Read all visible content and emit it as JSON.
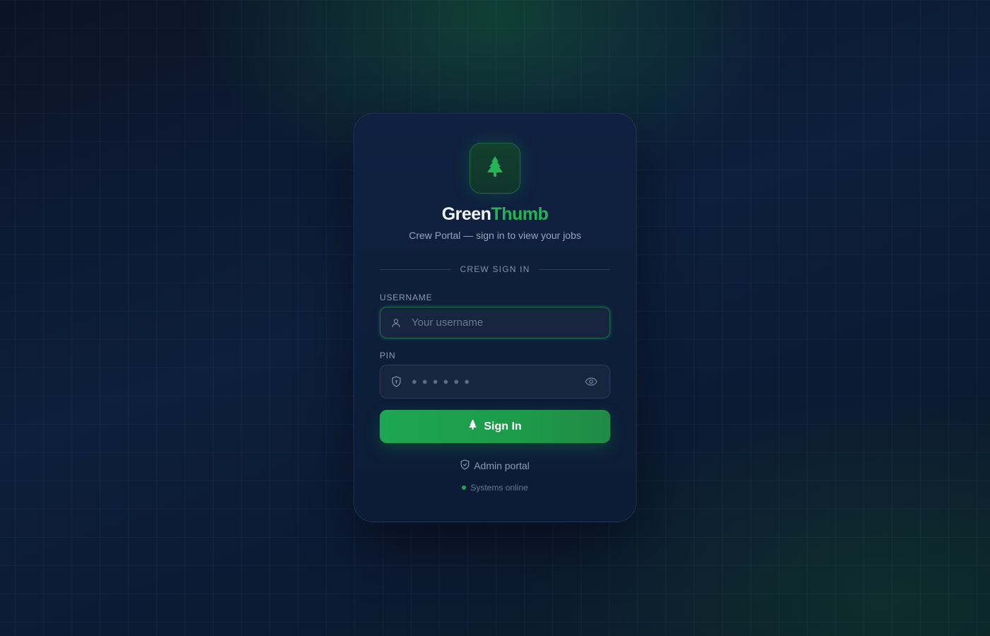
{
  "brand": {
    "name_part1": "Green",
    "name_part2": "Thumb",
    "logo_icon": "tree-icon",
    "subtitle": "Crew Portal — sign in to view your jobs"
  },
  "form": {
    "section_title": "CREW SIGN IN",
    "username": {
      "label": "USERNAME",
      "placeholder": "Your username",
      "value": "",
      "icon": "user-icon"
    },
    "pin": {
      "label": "PIN",
      "placeholder": "●●●●●●",
      "value": "",
      "icon": "shield-icon",
      "toggle_icon": "eye-icon"
    },
    "submit": {
      "label": "Sign In",
      "icon": "tree-icon"
    }
  },
  "footer": {
    "admin_link": "Admin portal",
    "admin_icon": "shield-check-icon",
    "status_text": "Systems online"
  },
  "colors": {
    "accent": "#22b455",
    "button": "#1ea652",
    "background": "#0d1f3d",
    "card": "#0f2140"
  }
}
